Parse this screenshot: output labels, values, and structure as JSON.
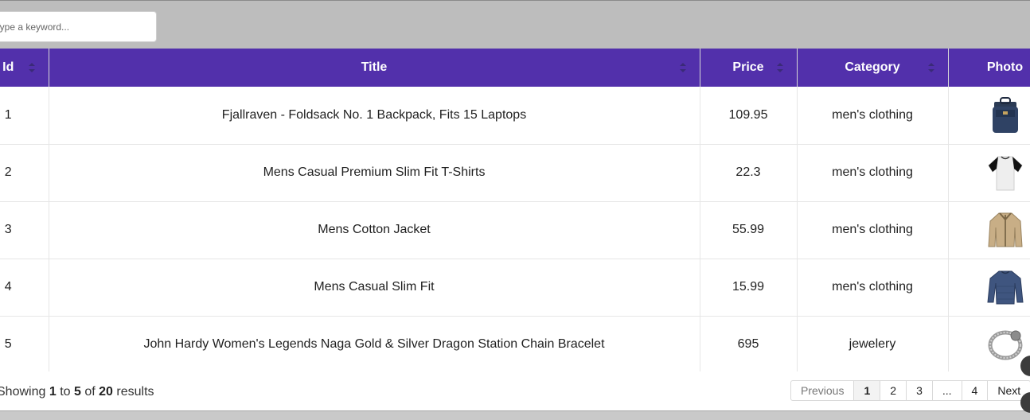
{
  "search": {
    "placeholder": "Type a keyword..."
  },
  "table": {
    "headers": [
      "Id",
      "Title",
      "Price",
      "Category",
      "Photo"
    ],
    "rows": [
      {
        "id": "1",
        "title": "Fjallraven - Foldsack No. 1 Backpack, Fits 15 Laptops",
        "price": "109.95",
        "category": "men's clothing",
        "photo": "backpack"
      },
      {
        "id": "2",
        "title": "Mens Casual Premium Slim Fit T-Shirts",
        "price": "22.3",
        "category": "men's clothing",
        "photo": "tshirt"
      },
      {
        "id": "3",
        "title": "Mens Cotton Jacket",
        "price": "55.99",
        "category": "men's clothing",
        "photo": "jacket"
      },
      {
        "id": "4",
        "title": "Mens Casual Slim Fit",
        "price": "15.99",
        "category": "men's clothing",
        "photo": "longsleeve"
      },
      {
        "id": "5",
        "title": "John Hardy Women's Legends Naga Gold & Silver Dragon Station Chain Bracelet",
        "price": "695",
        "category": "jewelery",
        "photo": "bracelet"
      }
    ]
  },
  "footer": {
    "showing_prefix": "Showing",
    "from": "1",
    "to_word": "to",
    "to": "5",
    "of_word": "of",
    "total": "20",
    "suffix": "results"
  },
  "pagination": {
    "previous": "Previous",
    "pages": [
      "1",
      "2",
      "3",
      "...",
      "4"
    ],
    "active": "1",
    "next": "Next"
  },
  "colors": {
    "header_bg": "#5230ab",
    "page_bg": "#bdbdbd"
  }
}
